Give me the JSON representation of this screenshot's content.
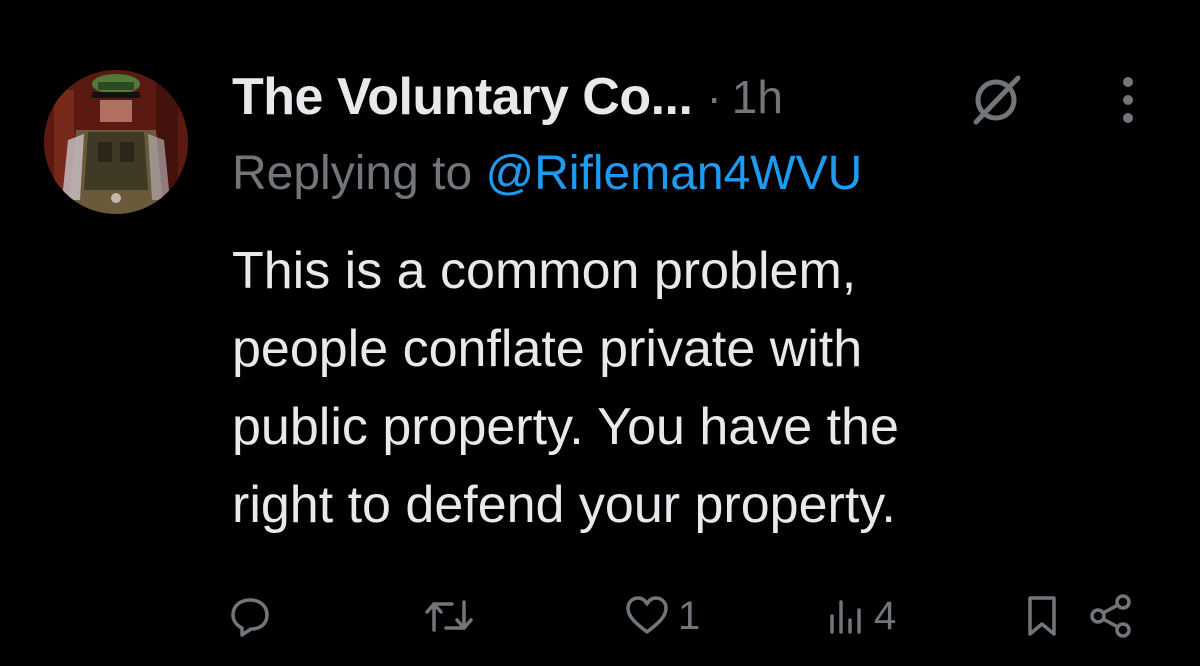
{
  "tweet": {
    "display_name": "The Voluntary Co...",
    "separator": "·",
    "timestamp": "1h",
    "replying_prefix": "Replying to ",
    "replying_handle": "@Rifleman4WVU",
    "body_lines": [
      "This is a common problem,",
      "people conflate private with",
      "public property. You have the",
      "right to defend your property."
    ]
  },
  "actions": {
    "likes": "1",
    "views": "4"
  },
  "icons": {
    "reply": "reply-icon",
    "retweet": "retweet-icon",
    "like": "heart-icon",
    "views": "views-icon",
    "bookmark": "bookmark-icon",
    "share": "share-icon",
    "grok": "grok-icon",
    "more": "more-vertical-icon"
  },
  "colors": {
    "background": "#000000",
    "text_primary": "#e7e9ea",
    "text_secondary": "#71767b",
    "link": "#1d9bf0"
  }
}
